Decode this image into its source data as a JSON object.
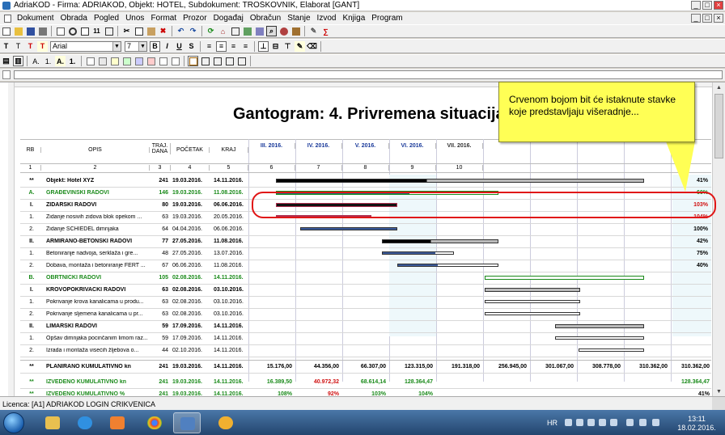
{
  "window": {
    "title": "AdriaKOD - Firma: ADRIAKOD,  Objekt: HOTEL,  Subdokument: TROŠKOVNIK,  Elaborat [GANT]"
  },
  "menu": [
    "Dokument",
    "Obrada",
    "Pogled",
    "Unos",
    "Format",
    "Prozor",
    "Događaj",
    "Obračun",
    "Stanje",
    "Izvod",
    "Knjiga",
    "Program"
  ],
  "toolbar": {
    "font_name": "Arial",
    "font_size": "7",
    "bold": "B",
    "italic": "I",
    "underline": "U",
    "strike": "S",
    "text_t1": "T",
    "text_t2": "T",
    "text_t3": "T",
    "text_t4": "T",
    "list_a": "A.",
    "list_1": "1.",
    "list_a2": "A.",
    "list_1b": "1."
  },
  "document": {
    "title": "Gantogram: 4. Privremena situacija",
    "headers": {
      "rb": "RB",
      "opis": "OPIS",
      "traj": "TRAJ. DANA",
      "pocetak": "POČETAK",
      "kraj": "KRAJ",
      "months": [
        "III. 2016.",
        "IV. 2016.",
        "V. 2016.",
        "VI. 2016.",
        "VII. 2016."
      ]
    },
    "col_numbers": [
      "1",
      "2",
      "3",
      "4",
      "5",
      "6",
      "7",
      "8",
      "9",
      "10"
    ],
    "rows": [
      {
        "rb": "**",
        "opis": "Objekt: Hotel XYZ",
        "traj": "241",
        "poc": "19.03.2016.",
        "kraj": "14.11.2016.",
        "pct": "41%",
        "style": "bold"
      },
      {
        "rb": "A.",
        "opis": "GRAĐEVINSKI RADOVI",
        "traj": "146",
        "poc": "19.03.2016.",
        "kraj": "11.08.2016.",
        "pct": "60%",
        "style": "green"
      },
      {
        "rb": "I.",
        "opis": "ZIDARSKI RADOVI",
        "traj": "80",
        "poc": "19.03.2016.",
        "kraj": "06.06.2016.",
        "pct": "103%",
        "style": "bold",
        "pct_style": "red"
      },
      {
        "rb": "1.",
        "opis": "Zidanje nosivih zidova blok opekom ...",
        "traj": "63",
        "poc": "19.03.2016.",
        "kraj": "20.05.2016.",
        "pct": "104%",
        "style": "",
        "pct_style": "red"
      },
      {
        "rb": "2.",
        "opis": "Zidanje SCHIEDEL dimnjaka",
        "traj": "64",
        "poc": "04.04.2016.",
        "kraj": "06.06.2016.",
        "pct": "100%",
        "style": ""
      },
      {
        "rb": "II.",
        "opis": "ARMIRANO-BETONSKI RADOVI",
        "traj": "77",
        "poc": "27.05.2016.",
        "kraj": "11.08.2016.",
        "pct": "42%",
        "style": "bold"
      },
      {
        "rb": "1.",
        "opis": "Betoniranje nadvoja, serklaža i gre...",
        "traj": "48",
        "poc": "27.05.2016.",
        "kraj": "13.07.2016.",
        "pct": "75%",
        "style": ""
      },
      {
        "rb": "2.",
        "opis": "Dobava, montaža i betoniranje FERT ...",
        "traj": "67",
        "poc": "06.06.2016.",
        "kraj": "11.08.2016.",
        "pct": "40%",
        "style": ""
      },
      {
        "rb": "B.",
        "opis": "OBRTNIČKI RADOVI",
        "traj": "105",
        "poc": "02.08.2016.",
        "kraj": "14.11.2016.",
        "pct": "",
        "style": "green"
      },
      {
        "rb": "I.",
        "opis": "KROVOPOKRIVAČKI RADOVI",
        "traj": "63",
        "poc": "02.08.2016.",
        "kraj": "03.10.2016.",
        "pct": "",
        "style": "bold"
      },
      {
        "rb": "1.",
        "opis": "Pokrivanje krova kanalicama u produ...",
        "traj": "63",
        "poc": "02.08.2016.",
        "kraj": "03.10.2016.",
        "pct": "",
        "style": ""
      },
      {
        "rb": "2.",
        "opis": "Pokrivanje sljemena kanalicama u pr...",
        "traj": "63",
        "poc": "02.08.2016.",
        "kraj": "03.10.2016.",
        "pct": "",
        "style": ""
      },
      {
        "rb": "II.",
        "opis": "LIMARSKI RADOVI",
        "traj": "59",
        "poc": "17.09.2016.",
        "kraj": "14.11.2016.",
        "pct": "",
        "style": "bold"
      },
      {
        "rb": "1.",
        "opis": "Opšav dimnjaka pocinčanim limom raz...",
        "traj": "59",
        "poc": "17.09.2016.",
        "kraj": "14.11.2016.",
        "pct": "",
        "style": ""
      },
      {
        "rb": "2.",
        "opis": "Izrada i montaža visećih žljebova o...",
        "traj": "44",
        "poc": "02.10.2016.",
        "kraj": "14.11.2016.",
        "pct": "",
        "style": ""
      }
    ],
    "totals": [
      {
        "rb": "**",
        "opis": "PLANIRANO KUMULATIVNO kn",
        "traj": "241",
        "poc": "19.03.2016.",
        "kraj": "14.11.2016.",
        "values": [
          "15.176,00",
          "44.356,00",
          "66.307,00",
          "123.315,00",
          "191.318,00",
          "256.945,00",
          "301.067,00",
          "308.778,00",
          "310.362,00",
          "310.362,00"
        ],
        "style": ""
      },
      {
        "rb": "**",
        "opis": "IZVEDENO KUMULATIVNO kn",
        "traj": "241",
        "poc": "19.03.2016.",
        "kraj": "14.11.2016.",
        "values": [
          "16.389,50",
          "40.972,32",
          "68.614,14",
          "128.364,47",
          "",
          "",
          "",
          "",
          "",
          "128.364,47"
        ],
        "style": "green",
        "value_styles": [
          "green",
          "red",
          "green",
          "green",
          "",
          "",
          "",
          "",
          "",
          "green"
        ]
      },
      {
        "rb": "**",
        "opis": "IZVEDENO KUMULATIVNO %",
        "traj": "241",
        "poc": "19.03.2016.",
        "kraj": "14.11.2016.",
        "values": [
          "108%",
          "92%",
          "103%",
          "104%",
          "",
          "",
          "",
          "",
          "",
          "41%"
        ],
        "style": "green",
        "value_styles": [
          "green",
          "red",
          "green",
          "green",
          "",
          "",
          "",
          "",
          "",
          ""
        ]
      }
    ]
  },
  "callout": {
    "text": "Crvenom bojom bit će istaknute stavke koje predstavljaju višeradnje..."
  },
  "statusbar": {
    "licence": "Licenca: [A1] ADRIAKOD LOGIN CRIKVENICA"
  },
  "taskbar": {
    "lang": "HR",
    "time": "13:11",
    "date": "18.02.2016."
  }
}
